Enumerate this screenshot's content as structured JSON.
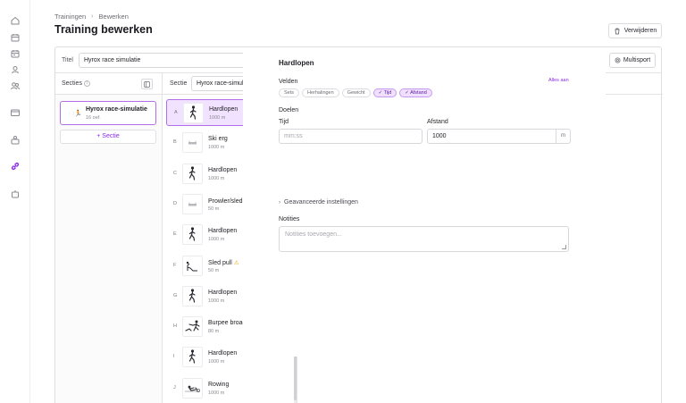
{
  "breadcrumb": {
    "items": [
      "Trainingen",
      "Bewerken"
    ],
    "separator": "›"
  },
  "page": {
    "title": "Training bewerken",
    "delete_label": "Verwijderen"
  },
  "training": {
    "title_label": "Titel",
    "title_value": "Hyrox race simulatie",
    "multisport_label": "Multisport"
  },
  "sections": {
    "header": "Secties",
    "info": "i",
    "items": [
      {
        "emoji": "🏃",
        "name": "Hyrox race-simulatie",
        "sub": "16 oef."
      }
    ],
    "add_label": "+ Sectie"
  },
  "section_editor": {
    "label": "Sectie",
    "value": "Hyrox race-simulatie"
  },
  "exercises": [
    {
      "letter": "A",
      "name": "Hardlopen",
      "dist": "1000 m",
      "icon": "runner-icon",
      "active": true,
      "warn": false
    },
    {
      "letter": "B",
      "name": "Ski erg",
      "dist": "1000 m",
      "icon": "ski-erg-icon",
      "active": false,
      "warn": false
    },
    {
      "letter": "C",
      "name": "Hardlopen",
      "dist": "1000 m",
      "icon": "runner-icon",
      "active": false,
      "warn": false
    },
    {
      "letter": "D",
      "name": "Prowler/sled pushes",
      "dist": "50 m",
      "icon": "sled-icon",
      "active": false,
      "warn": true
    },
    {
      "letter": "E",
      "name": "Hardlopen",
      "dist": "1000 m",
      "icon": "runner-icon",
      "active": false,
      "warn": false
    },
    {
      "letter": "F",
      "name": "Sled pull",
      "dist": "50 m",
      "icon": "sled-pull-icon",
      "active": false,
      "warn": true
    },
    {
      "letter": "G",
      "name": "Hardlopen",
      "dist": "1000 m",
      "icon": "runner-icon",
      "active": false,
      "warn": false
    },
    {
      "letter": "H",
      "name": "Burpee broad jumps",
      "dist": "80 m",
      "icon": "burpee-icon",
      "active": false,
      "warn": false
    },
    {
      "letter": "I",
      "name": "Hardlopen",
      "dist": "1000 m",
      "icon": "runner-icon",
      "active": false,
      "warn": false
    },
    {
      "letter": "J",
      "name": "Rowing",
      "dist": "1000 m",
      "icon": "rowing-icon",
      "active": false,
      "warn": false
    }
  ],
  "editor": {
    "title": "Hardlopen",
    "fields_label": "Velden",
    "all_on_label": "Alles aan",
    "chips": [
      {
        "label": "Sets",
        "on": false
      },
      {
        "label": "Herhalingen",
        "on": false
      },
      {
        "label": "Gewicht",
        "on": false
      },
      {
        "label": "✓ Tijd",
        "on": true
      },
      {
        "label": "✓ Afstand",
        "on": true
      }
    ],
    "goals_label": "Doelen",
    "time_label": "Tijd",
    "time_placeholder": "mm:ss",
    "distance_label": "Afstand",
    "distance_value": "1000",
    "distance_unit": "m",
    "advanced_label": "Geavanceerde instellingen",
    "notes_label": "Notities",
    "notes_placeholder": "Notities toevoegen..."
  },
  "colors": {
    "accent": "#8a2be2",
    "accent_light": "#f1e2ff",
    "warning": "#e0a500"
  }
}
